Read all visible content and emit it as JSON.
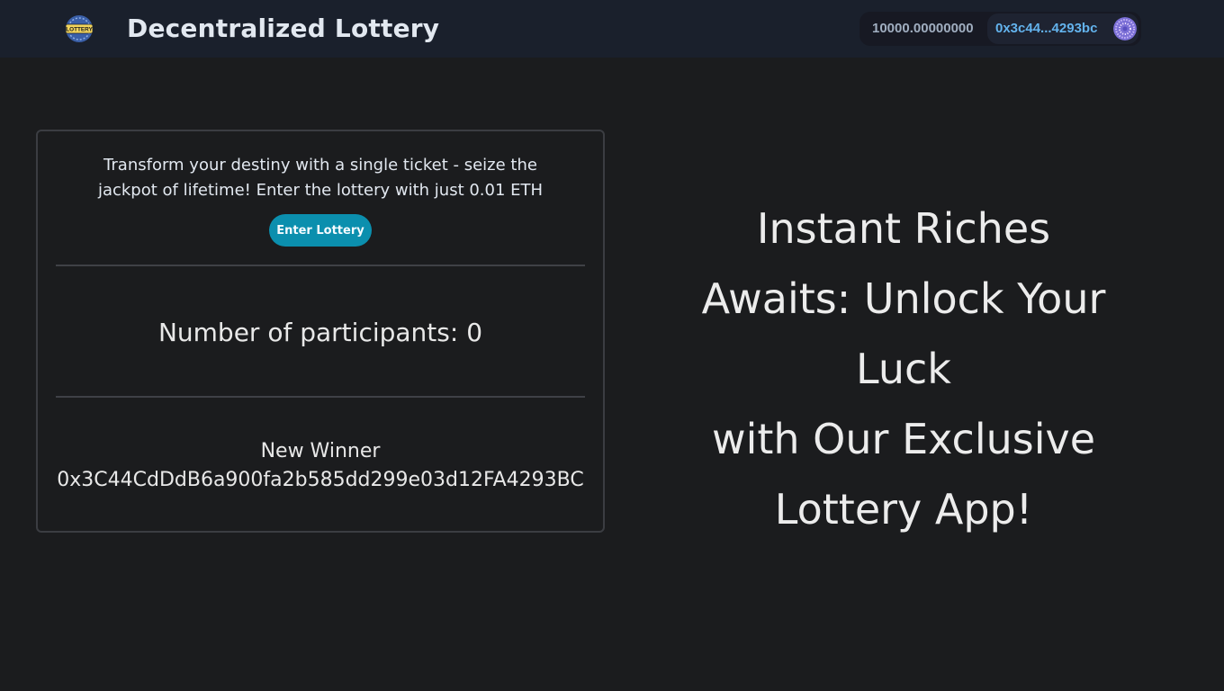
{
  "header": {
    "logo_text": "LOTTERY",
    "title": "Decentralized Lottery",
    "wallet": {
      "balance": "10000.00000000",
      "address_short": "0x3c44...4293bc",
      "avatar_icon": "identicon-avatar"
    }
  },
  "lottery_card": {
    "promo_lines": [
      "Transform your destiny with a single ticket - seize the",
      "jackpot of lifetime! Enter the lottery with just 0.01 ETH"
    ],
    "enter_button_label": "Enter Lottery",
    "participants_text": "Number of participants: 0",
    "winner_label": "New Winner",
    "winner_address": "0x3C44CdDdB6a900fa2b585dd299e03d12FA4293BC"
  },
  "hero": {
    "lines": [
      "Instant Riches",
      "Awaits: Unlock Your Luck",
      "with Our Exclusive",
      "Lottery App!"
    ]
  },
  "colors": {
    "background": "#1b1c1e",
    "navbar": "#1a202c",
    "accent_button": "#0b8fae",
    "address_link": "#63b3ed"
  }
}
